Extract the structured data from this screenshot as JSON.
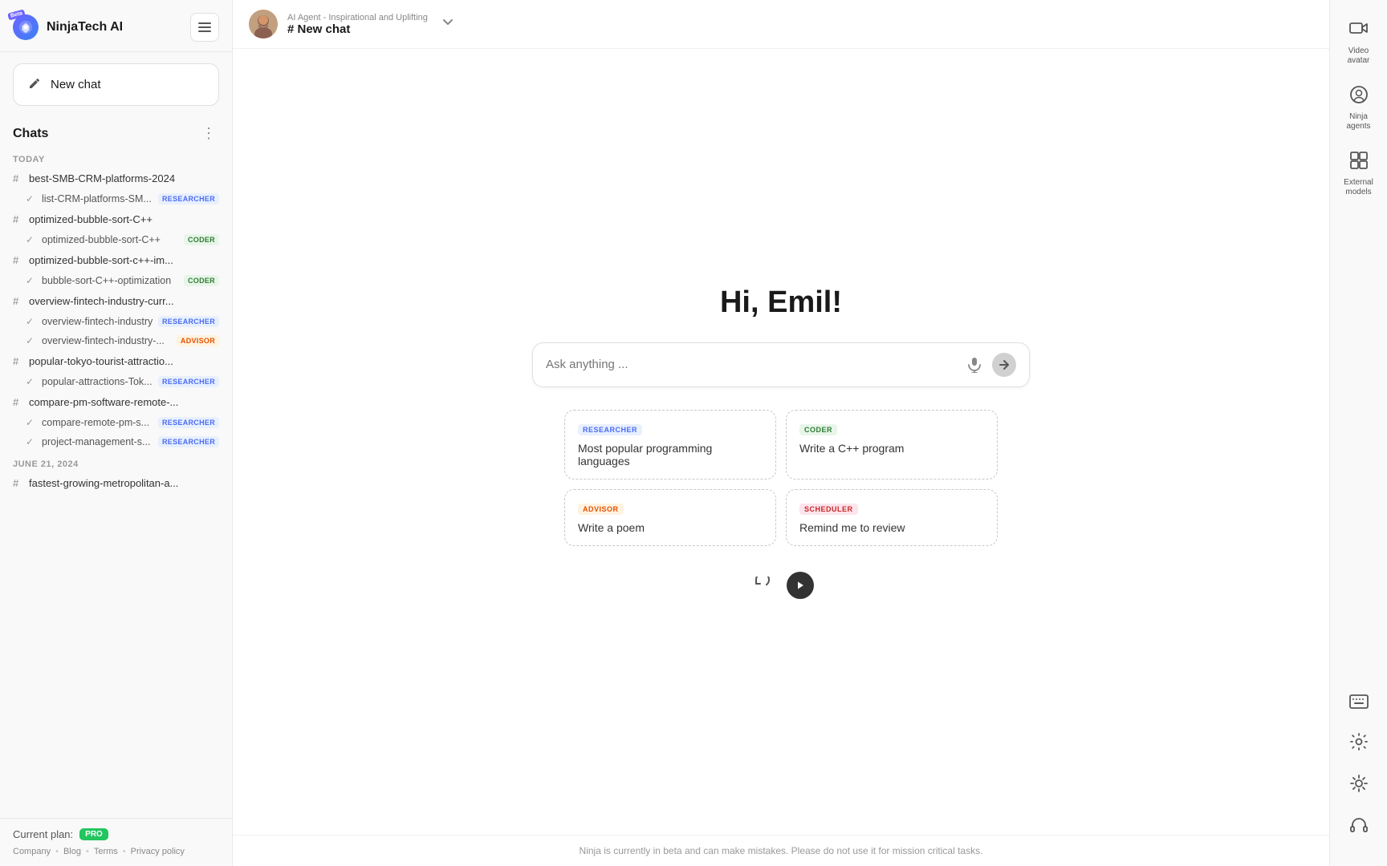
{
  "app": {
    "name": "NinjaTech AI",
    "beta_label": "Beta"
  },
  "sidebar": {
    "new_chat_label": "New chat",
    "chats_title": "Chats",
    "current_plan_label": "Current plan:",
    "pro_badge": "PRO",
    "footer_links": [
      "Company",
      "Blog",
      "Terms",
      "Privacy policy"
    ],
    "date_groups": [
      {
        "label": "TODAY",
        "items": [
          {
            "id": "best-smb",
            "type": "group",
            "label": "best-SMB-CRM-platforms-2024",
            "sub": [
              {
                "label": "list-CRM-platforms-SM...",
                "badge": "RESEARCHER",
                "badge_type": "researcher"
              }
            ]
          },
          {
            "id": "optimized-bubble",
            "type": "group",
            "label": "optimized-bubble-sort-C++",
            "sub": [
              {
                "label": "optimized-bubble-sort-C++",
                "badge": "CODER",
                "badge_type": "coder"
              }
            ]
          },
          {
            "id": "optimized-bubble-im",
            "type": "group",
            "label": "optimized-bubble-sort-c++-im...",
            "sub": [
              {
                "label": "bubble-sort-C++-optimization",
                "badge": "CODER",
                "badge_type": "coder"
              }
            ]
          },
          {
            "id": "overview-fintech",
            "type": "group",
            "label": "overview-fintech-industry-curr...",
            "sub": [
              {
                "label": "overview-fintech-industry",
                "badge": "RESEARCHER",
                "badge_type": "researcher"
              },
              {
                "label": "overview-fintech-industry-...",
                "badge": "ADVISOR",
                "badge_type": "advisor"
              }
            ]
          },
          {
            "id": "popular-tokyo",
            "type": "group",
            "label": "popular-tokyo-tourist-attractio...",
            "sub": [
              {
                "label": "popular-attractions-Tok...",
                "badge": "RESEARCHER",
                "badge_type": "researcher"
              }
            ]
          },
          {
            "id": "compare-pm",
            "type": "group",
            "label": "compare-pm-software-remote-...",
            "sub": [
              {
                "label": "compare-remote-pm-s...",
                "badge": "RESEARCHER",
                "badge_type": "researcher"
              },
              {
                "label": "project-management-s...",
                "badge": "RESEARCHER",
                "badge_type": "researcher"
              }
            ]
          }
        ]
      },
      {
        "label": "JUNE 21, 2024",
        "items": [
          {
            "id": "fastest-growing",
            "type": "group",
            "label": "fastest-growing-metropolitan-a...",
            "sub": []
          }
        ]
      }
    ]
  },
  "topbar": {
    "agent_type": "AI Agent - Inspirational and Uplifting",
    "chat_title": "# New chat",
    "agent_avatar_color": "#ff8c42"
  },
  "main": {
    "greeting": "Hi, Emil!",
    "input_placeholder": "Ask anything ...",
    "bottom_notice": "Ninja is currently in beta and can make mistakes. Please do not use it for mission critical tasks."
  },
  "suggestions": [
    {
      "badge": "RESEARCHER",
      "badge_type": "researcher",
      "text": "Most popular programming languages"
    },
    {
      "badge": "CODER",
      "badge_type": "coder",
      "text": "Write a C++ program"
    },
    {
      "badge": "ADVISOR",
      "badge_type": "advisor",
      "text": "Write a poem"
    },
    {
      "badge": "SCHEDULER",
      "badge_type": "scheduler",
      "text": "Remind me to review"
    }
  ],
  "right_nav": {
    "items": [
      {
        "id": "video-avatar",
        "icon": "video",
        "label": "Video avatar"
      },
      {
        "id": "ninja-agents",
        "icon": "ninja",
        "label": "Ninja agents"
      },
      {
        "id": "external-models",
        "icon": "external",
        "label": "External models"
      }
    ],
    "bottom_items": [
      {
        "id": "keyboard",
        "icon": "keyboard"
      },
      {
        "id": "settings",
        "icon": "settings"
      },
      {
        "id": "theme",
        "icon": "theme"
      },
      {
        "id": "headset",
        "icon": "headset"
      }
    ]
  }
}
